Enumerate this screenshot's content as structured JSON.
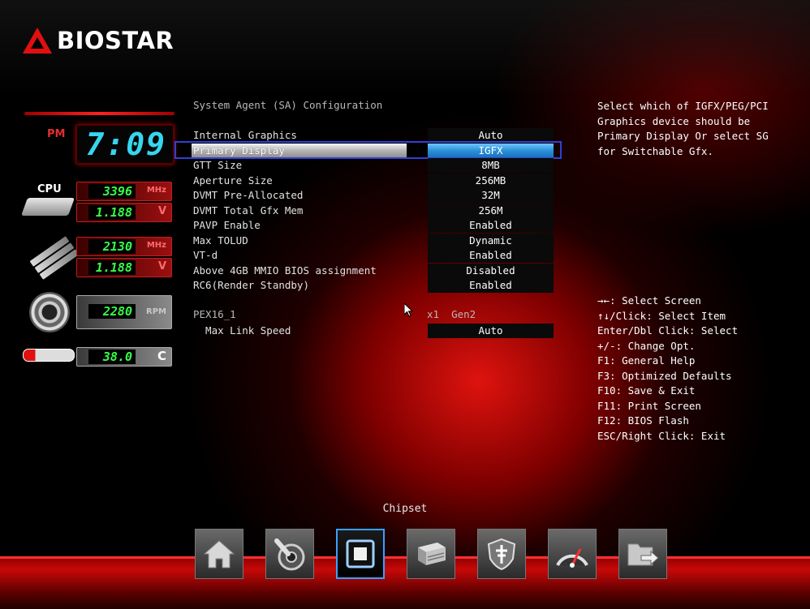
{
  "brand": {
    "logo_text": "BIOSTAR"
  },
  "monitor": {
    "ampm": "PM",
    "time": "7:09",
    "cpu_label": "CPU",
    "cpu_freq": "3396",
    "cpu_freq_unit": "MHz",
    "cpu_volt": "1.188",
    "cpu_volt_unit": "V",
    "mem_freq": "2130",
    "mem_freq_unit": "MHz",
    "mem_volt": "1.188",
    "mem_volt_unit": "V",
    "fan_rpm": "2280",
    "fan_unit": "RPM",
    "temp": "38.0",
    "temp_unit": "C"
  },
  "main": {
    "section_title": "System Agent (SA) Configuration",
    "settings": [
      {
        "label": "Internal Graphics",
        "value": "Auto"
      },
      {
        "label": "Primary Display",
        "value": "IGFX"
      },
      {
        "label": "GTT Size",
        "value": "8MB"
      },
      {
        "label": "Aperture Size",
        "value": "256MB"
      },
      {
        "label": "DVMT Pre-Allocated",
        "value": "32M"
      },
      {
        "label": "DVMT Total Gfx Mem",
        "value": "256M"
      },
      {
        "label": "PAVP Enable",
        "value": "Enabled"
      },
      {
        "label": "Max TOLUD",
        "value": "Dynamic"
      },
      {
        "label": "VT-d",
        "value": "Enabled"
      },
      {
        "label": "Above 4GB MMIO BIOS assignment",
        "value": "Disabled"
      },
      {
        "label": "RC6(Render Standby)",
        "value": "Enabled"
      }
    ],
    "pex_title": "PEX16_1",
    "pex_info": "x1  Gen2",
    "pex_setting": {
      "label": "  Max Link Speed",
      "value": "Auto"
    }
  },
  "help": {
    "description": "Select which of IGFX/PEG/PCI Graphics device should be Primary Display Or select SG for Switchable Gfx.",
    "keys": [
      "→←: Select Screen",
      "↑↓/Click: Select Item",
      "Enter/Dbl Click: Select",
      "+/-: Change Opt.",
      "F1: General Help",
      "F3: Optimized Defaults",
      "F10: Save & Exit",
      "F11: Print Screen",
      "F12: BIOS Flash",
      "ESC/Right Click: Exit"
    ]
  },
  "dock": {
    "active_label": "Chipset",
    "items": [
      {
        "icon": "home-icon"
      },
      {
        "icon": "advanced-icon"
      },
      {
        "icon": "chipset-icon"
      },
      {
        "icon": "boot-icon"
      },
      {
        "icon": "security-icon"
      },
      {
        "icon": "overclock-icon"
      },
      {
        "icon": "exit-icon"
      }
    ]
  }
}
